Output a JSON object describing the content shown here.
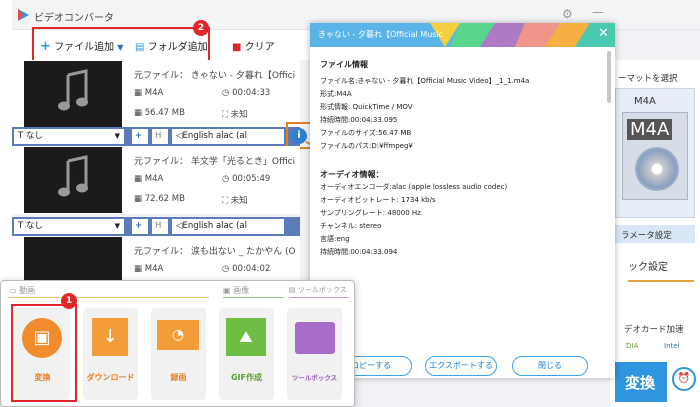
{
  "window": {
    "title": "ビデオコンバータ"
  },
  "toolbar": {
    "add_file": "ファイル追加",
    "add_folder": "フォルダ追加",
    "clear": "クリア"
  },
  "callouts": {
    "one": "1",
    "two": "2"
  },
  "files": [
    {
      "source": "元ファイル： きゃない - 夕暮れ【Offici",
      "format": "M4A",
      "duration": "00:04:33",
      "size": "56.47 MB",
      "resolution": "未知",
      "subtitle": "なし",
      "audio": "English alac (al"
    },
    {
      "source": "元ファイル： 羊文学「光るとき」Offici",
      "format": "M4A",
      "duration": "00:05:49",
      "size": "72.62 MB",
      "resolution": "未知",
      "subtitle": "なし",
      "audio": "English alac (al"
    },
    {
      "source": "元ファイル： 涙も出ない _ たかやん (O",
      "format": "M4A",
      "duration": "00:04:02",
      "subtitle": "なし"
    }
  ],
  "popup": {
    "title": "きゃない - 夕暮れ【Official Music",
    "file_heading": "ファイル情報",
    "file_lines": [
      "ファイル名:きゃない - 夕暮れ【Official Music Video】_1_1.m4a",
      "形式:M4A",
      "形式情報: QuickTime / MOV",
      "持続時間:00:04:33.095",
      "ファイルのサイズ:56.47 MB",
      "ファイルのパス:D:¥ffmpeg¥"
    ],
    "audio_heading": "オーディオ情報：",
    "audio_lines": [
      "オーディオエンコーダ:alac (apple lossless audio codec)",
      "オーディオビットレート: 1734 kb/s",
      "サンプリングレート: 48000 Hz",
      "チャンネル: stereo",
      "言語:eng",
      "持続時間:00:04:33.094"
    ],
    "copy_btn": "コピーする",
    "export_btn": "エクスポートする",
    "close_btn": "閉じる"
  },
  "right_panel": {
    "format_select": "ーマットを選択",
    "format": "M4A",
    "format_big": "M4A",
    "params": "ラメータ設定",
    "batch": "ック設定",
    "gpu": "デオカード加速",
    "nvidia": "DIA",
    "intel": "Intel",
    "convert": "変換"
  },
  "launcher": {
    "section_video": "動画",
    "section_image": "画像",
    "section_tools": "ツールボックス",
    "tiles": [
      "変換",
      "ダウンロード",
      "録画",
      "GIF作成",
      "ツールボックス"
    ]
  },
  "colors": {
    "accent": "#e67e22",
    "brand_blue": "#2f95e0",
    "bar_blue": "#5b7bb9",
    "callout_red": "#e0262b"
  }
}
